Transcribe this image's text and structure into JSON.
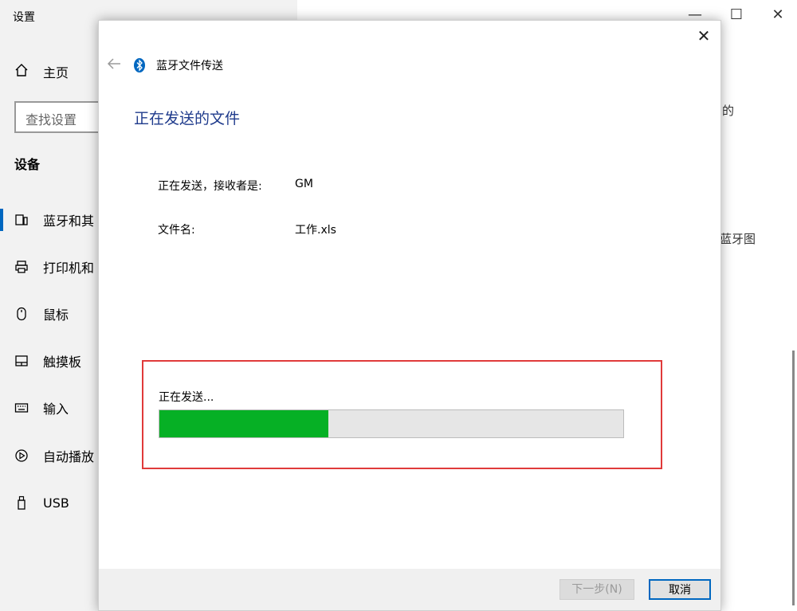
{
  "settings": {
    "title": "设置",
    "home_label": "主页",
    "search_placeholder": "查找设置",
    "section_title": "设备",
    "nav": [
      {
        "label": "蓝牙和其",
        "icon": "bluetooth-devices-icon",
        "active": true
      },
      {
        "label": "打印机和",
        "icon": "printer-icon",
        "active": false
      },
      {
        "label": "鼠标",
        "icon": "mouse-icon",
        "active": false
      },
      {
        "label": "触摸板",
        "icon": "touchpad-icon",
        "active": false
      },
      {
        "label": "输入",
        "icon": "keyboard-icon",
        "active": false
      },
      {
        "label": "自动播放",
        "icon": "autoplay-icon",
        "active": false
      },
      {
        "label": "USB",
        "icon": "usb-icon",
        "active": false
      }
    ],
    "right_fragments": [
      "的",
      "蓝牙图"
    ]
  },
  "window_controls": {
    "minimize": "—",
    "maximize": "☐",
    "close": "✕"
  },
  "dialog": {
    "title": "蓝牙文件传送",
    "heading": "正在发送的文件",
    "recipient_label": "正在发送，接收者是:",
    "recipient_value": "GM",
    "filename_label": "文件名:",
    "filename_value": "工作.xls",
    "progress_label": "正在发送...",
    "progress_fraction": 0.364,
    "buttons": {
      "next": "下一步(N)",
      "cancel": "取消"
    },
    "close": "✕"
  },
  "colors": {
    "accent": "#0067c0",
    "progress": "#06b025",
    "highlight": "#e03a3a",
    "heading": "#1f3b8c"
  }
}
